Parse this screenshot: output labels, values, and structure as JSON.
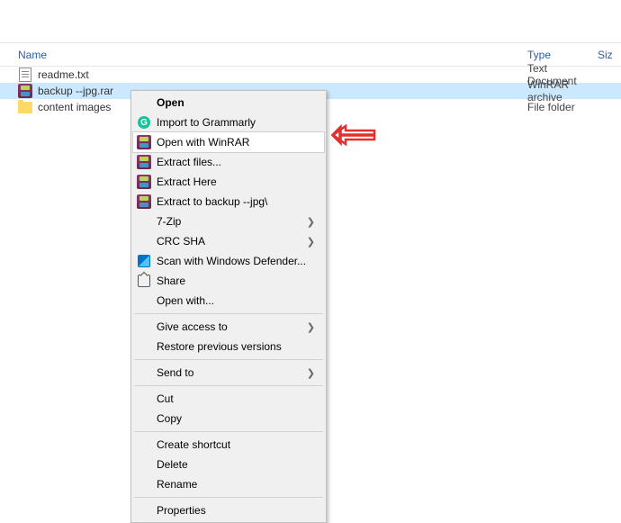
{
  "columns": {
    "name": "Name",
    "type": "Type",
    "size": "Siz"
  },
  "files": [
    {
      "name": "readme.txt",
      "type": "Text Document",
      "icon": "txt"
    },
    {
      "name": "backup --jpg.rar",
      "type": "WinRAR archive",
      "icon": "rar",
      "selected": true
    },
    {
      "name": "content images",
      "type": "File folder",
      "icon": "folder"
    }
  ],
  "context_menu": [
    {
      "kind": "item",
      "label": "Open",
      "bold": true
    },
    {
      "kind": "item",
      "label": "Import to Grammarly",
      "icon": "grammarly"
    },
    {
      "kind": "item",
      "label": "Open with WinRAR",
      "icon": "rar",
      "highlighted": true
    },
    {
      "kind": "item",
      "label": "Extract files...",
      "icon": "rar"
    },
    {
      "kind": "item",
      "label": "Extract Here",
      "icon": "rar"
    },
    {
      "kind": "item",
      "label": "Extract to backup --jpg\\",
      "icon": "rar"
    },
    {
      "kind": "item",
      "label": "7-Zip",
      "submenu": true
    },
    {
      "kind": "item",
      "label": "CRC SHA",
      "submenu": true
    },
    {
      "kind": "item",
      "label": "Scan with Windows Defender...",
      "icon": "defender"
    },
    {
      "kind": "item",
      "label": "Share",
      "icon": "share"
    },
    {
      "kind": "item",
      "label": "Open with..."
    },
    {
      "kind": "sep"
    },
    {
      "kind": "item",
      "label": "Give access to",
      "submenu": true
    },
    {
      "kind": "item",
      "label": "Restore previous versions"
    },
    {
      "kind": "sep"
    },
    {
      "kind": "item",
      "label": "Send to",
      "submenu": true
    },
    {
      "kind": "sep"
    },
    {
      "kind": "item",
      "label": "Cut"
    },
    {
      "kind": "item",
      "label": "Copy"
    },
    {
      "kind": "sep"
    },
    {
      "kind": "item",
      "label": "Create shortcut"
    },
    {
      "kind": "item",
      "label": "Delete"
    },
    {
      "kind": "item",
      "label": "Rename"
    },
    {
      "kind": "sep"
    },
    {
      "kind": "item",
      "label": "Properties"
    }
  ]
}
